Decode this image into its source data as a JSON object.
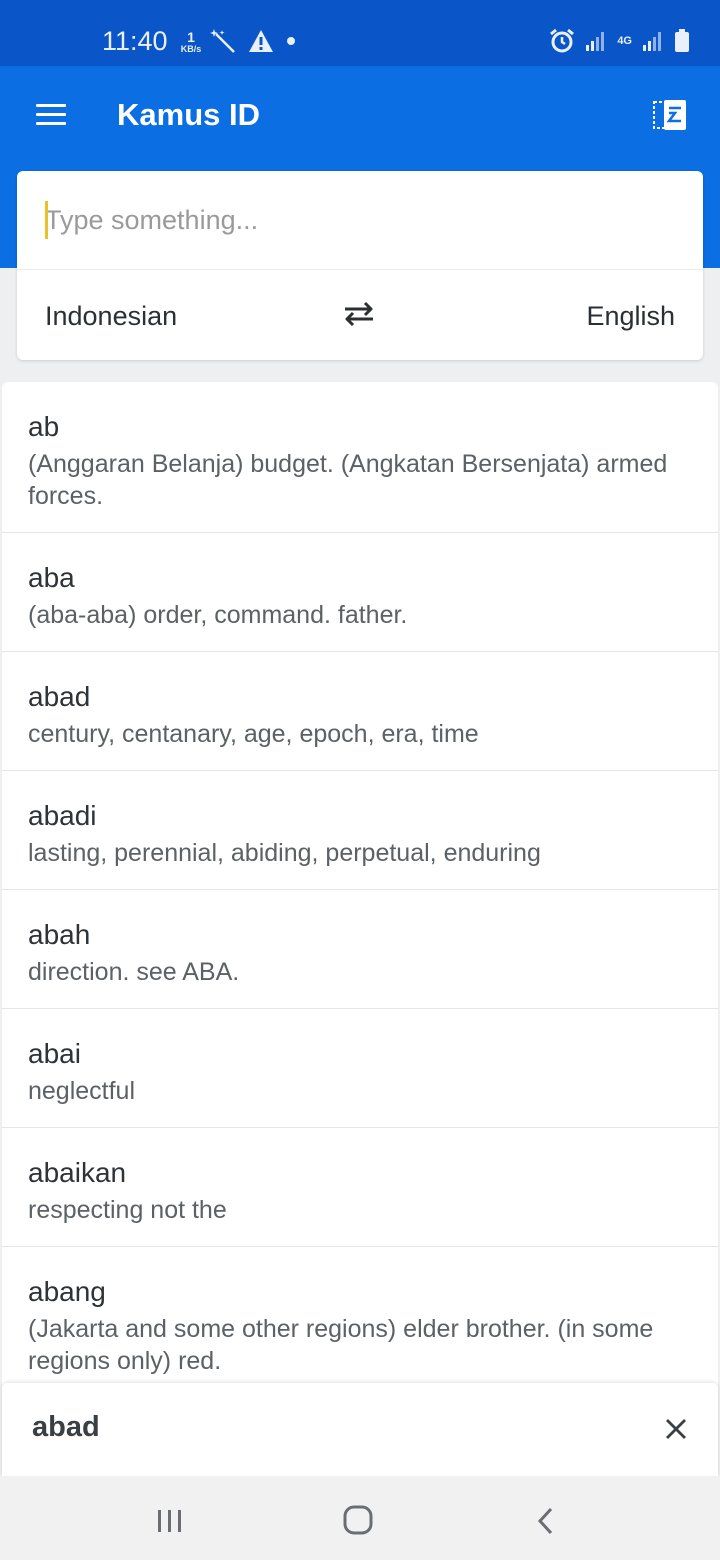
{
  "status_bar": {
    "time": "11:40",
    "speed_value": "1",
    "speed_unit": "KB/s",
    "network_label": "4G"
  },
  "app_bar": {
    "title": "Kamus ID"
  },
  "search": {
    "placeholder": "Type something...",
    "from_language": "Indonesian",
    "to_language": "English"
  },
  "entries": [
    {
      "word": "ab",
      "definition": "(Anggaran Belanja) budget. (Angkatan Bersenjata) armed forces."
    },
    {
      "word": "aba",
      "definition": "(aba-aba) order, command. father."
    },
    {
      "word": "abad",
      "definition": "century, centanary, age, epoch, era, time"
    },
    {
      "word": "abadi",
      "definition": "lasting, perennial, abiding, perpetual, enduring"
    },
    {
      "word": "abah",
      "definition": "direction. see ABA."
    },
    {
      "word": "abai",
      "definition": "neglectful"
    },
    {
      "word": "abaikan",
      "definition": "respecting not the"
    },
    {
      "word": "abang",
      "definition": "(Jakarta and some other regions) elder brother. (in some regions only) red."
    }
  ],
  "bottom_bar": {
    "word": "abad"
  },
  "colors": {
    "status_bar": "#0a55c7",
    "app_bar": "#0b6ee2",
    "caret": "#e9c12a",
    "background": "#eeeff1"
  },
  "icons": [
    "menu-icon",
    "document-translate-icon",
    "swap-icon",
    "close-icon",
    "alarm-icon",
    "signal-icon",
    "battery-icon",
    "wand-icon",
    "warning-icon"
  ]
}
